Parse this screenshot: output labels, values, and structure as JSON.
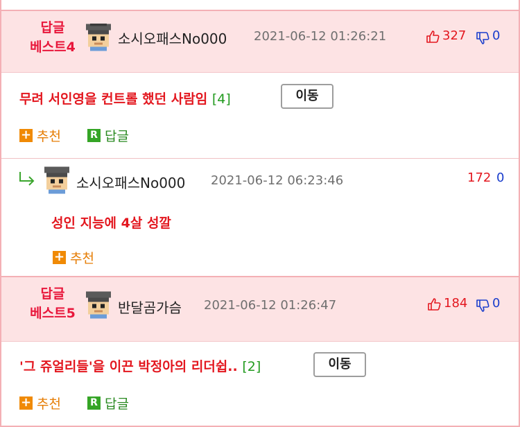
{
  "comments": [
    {
      "best_label_line1": "답글",
      "best_label_line2": "베스트4",
      "nickname": "소시오패스No000",
      "timestamp": "2021-06-12 01:26:21",
      "likes": "327",
      "dislikes": "0",
      "title": "무려 서인영을 컨트롤 했던 사람임",
      "reply_count": "[4]",
      "move_label": "이동",
      "recommend_label": "추천",
      "reply_label": "답글"
    },
    {
      "best_label_line1": "답글",
      "best_label_line2": "베스트5",
      "nickname": "반달곰가슴",
      "timestamp": "2021-06-12 01:26:47",
      "likes": "184",
      "dislikes": "0",
      "title": "'그 쥬얼리들'을 이끈 박정아의 리더쉽..",
      "reply_count": "[2]",
      "move_label": "이동",
      "recommend_label": "추천",
      "reply_label": "답글"
    }
  ],
  "reply": {
    "nickname": "소시오패스No000",
    "timestamp": "2021-06-12 06:23:46",
    "likes": "172",
    "dislikes": "0",
    "body": "성인 지능에 4살 성깔",
    "recommend_label": "추천"
  },
  "icons": {
    "recommend": "plus-square-icon",
    "reply": "r-square-icon",
    "like": "thumbs-up-icon",
    "dislike": "thumbs-down-icon",
    "reply_arrow": "reply-arrow-icon",
    "avatar": "pixel-avatar-icon"
  },
  "colors": {
    "best_bg": "#fde3e4",
    "border": "#f4b0b5",
    "title_red": "#e3171f",
    "count_green": "#219a1e",
    "like_red": "#e3171f",
    "dislike_blue": "#1a3dcc",
    "recommend_orange": "#f08a05",
    "reply_green": "#35a526"
  }
}
